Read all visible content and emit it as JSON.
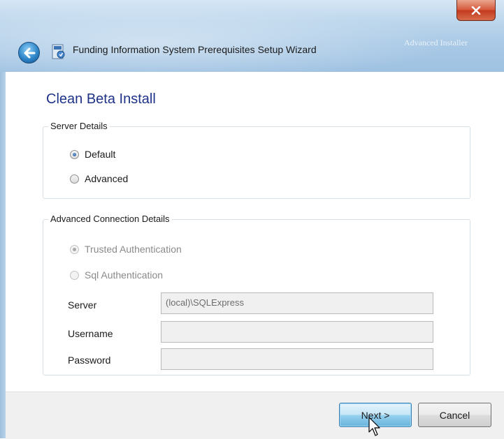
{
  "window": {
    "title": "Funding Information System Prerequisites Setup Wizard",
    "brand": "Advanced Installer"
  },
  "page": {
    "heading": "Clean Beta Install"
  },
  "server_details": {
    "legend": "Server Details",
    "options": [
      {
        "label": "Default",
        "checked": true
      },
      {
        "label": "Advanced",
        "checked": false
      }
    ]
  },
  "connection_details": {
    "legend": "Advanced Connection Details",
    "auth_options": [
      {
        "label": "Trusted Authentication",
        "checked": true,
        "disabled": true
      },
      {
        "label": "Sql Authentication",
        "checked": false,
        "disabled": true
      }
    ],
    "fields": {
      "server": {
        "label": "Server",
        "value": "(local)\\SQLExpress"
      },
      "username": {
        "label": "Username",
        "value": ""
      },
      "password": {
        "label": "Password",
        "value": ""
      }
    }
  },
  "buttons": {
    "next": "Next >",
    "cancel": "Cancel"
  },
  "colors": {
    "heading": "#1e3287",
    "titlebar": "#a9c9e6",
    "close_button": "#c4391f"
  }
}
